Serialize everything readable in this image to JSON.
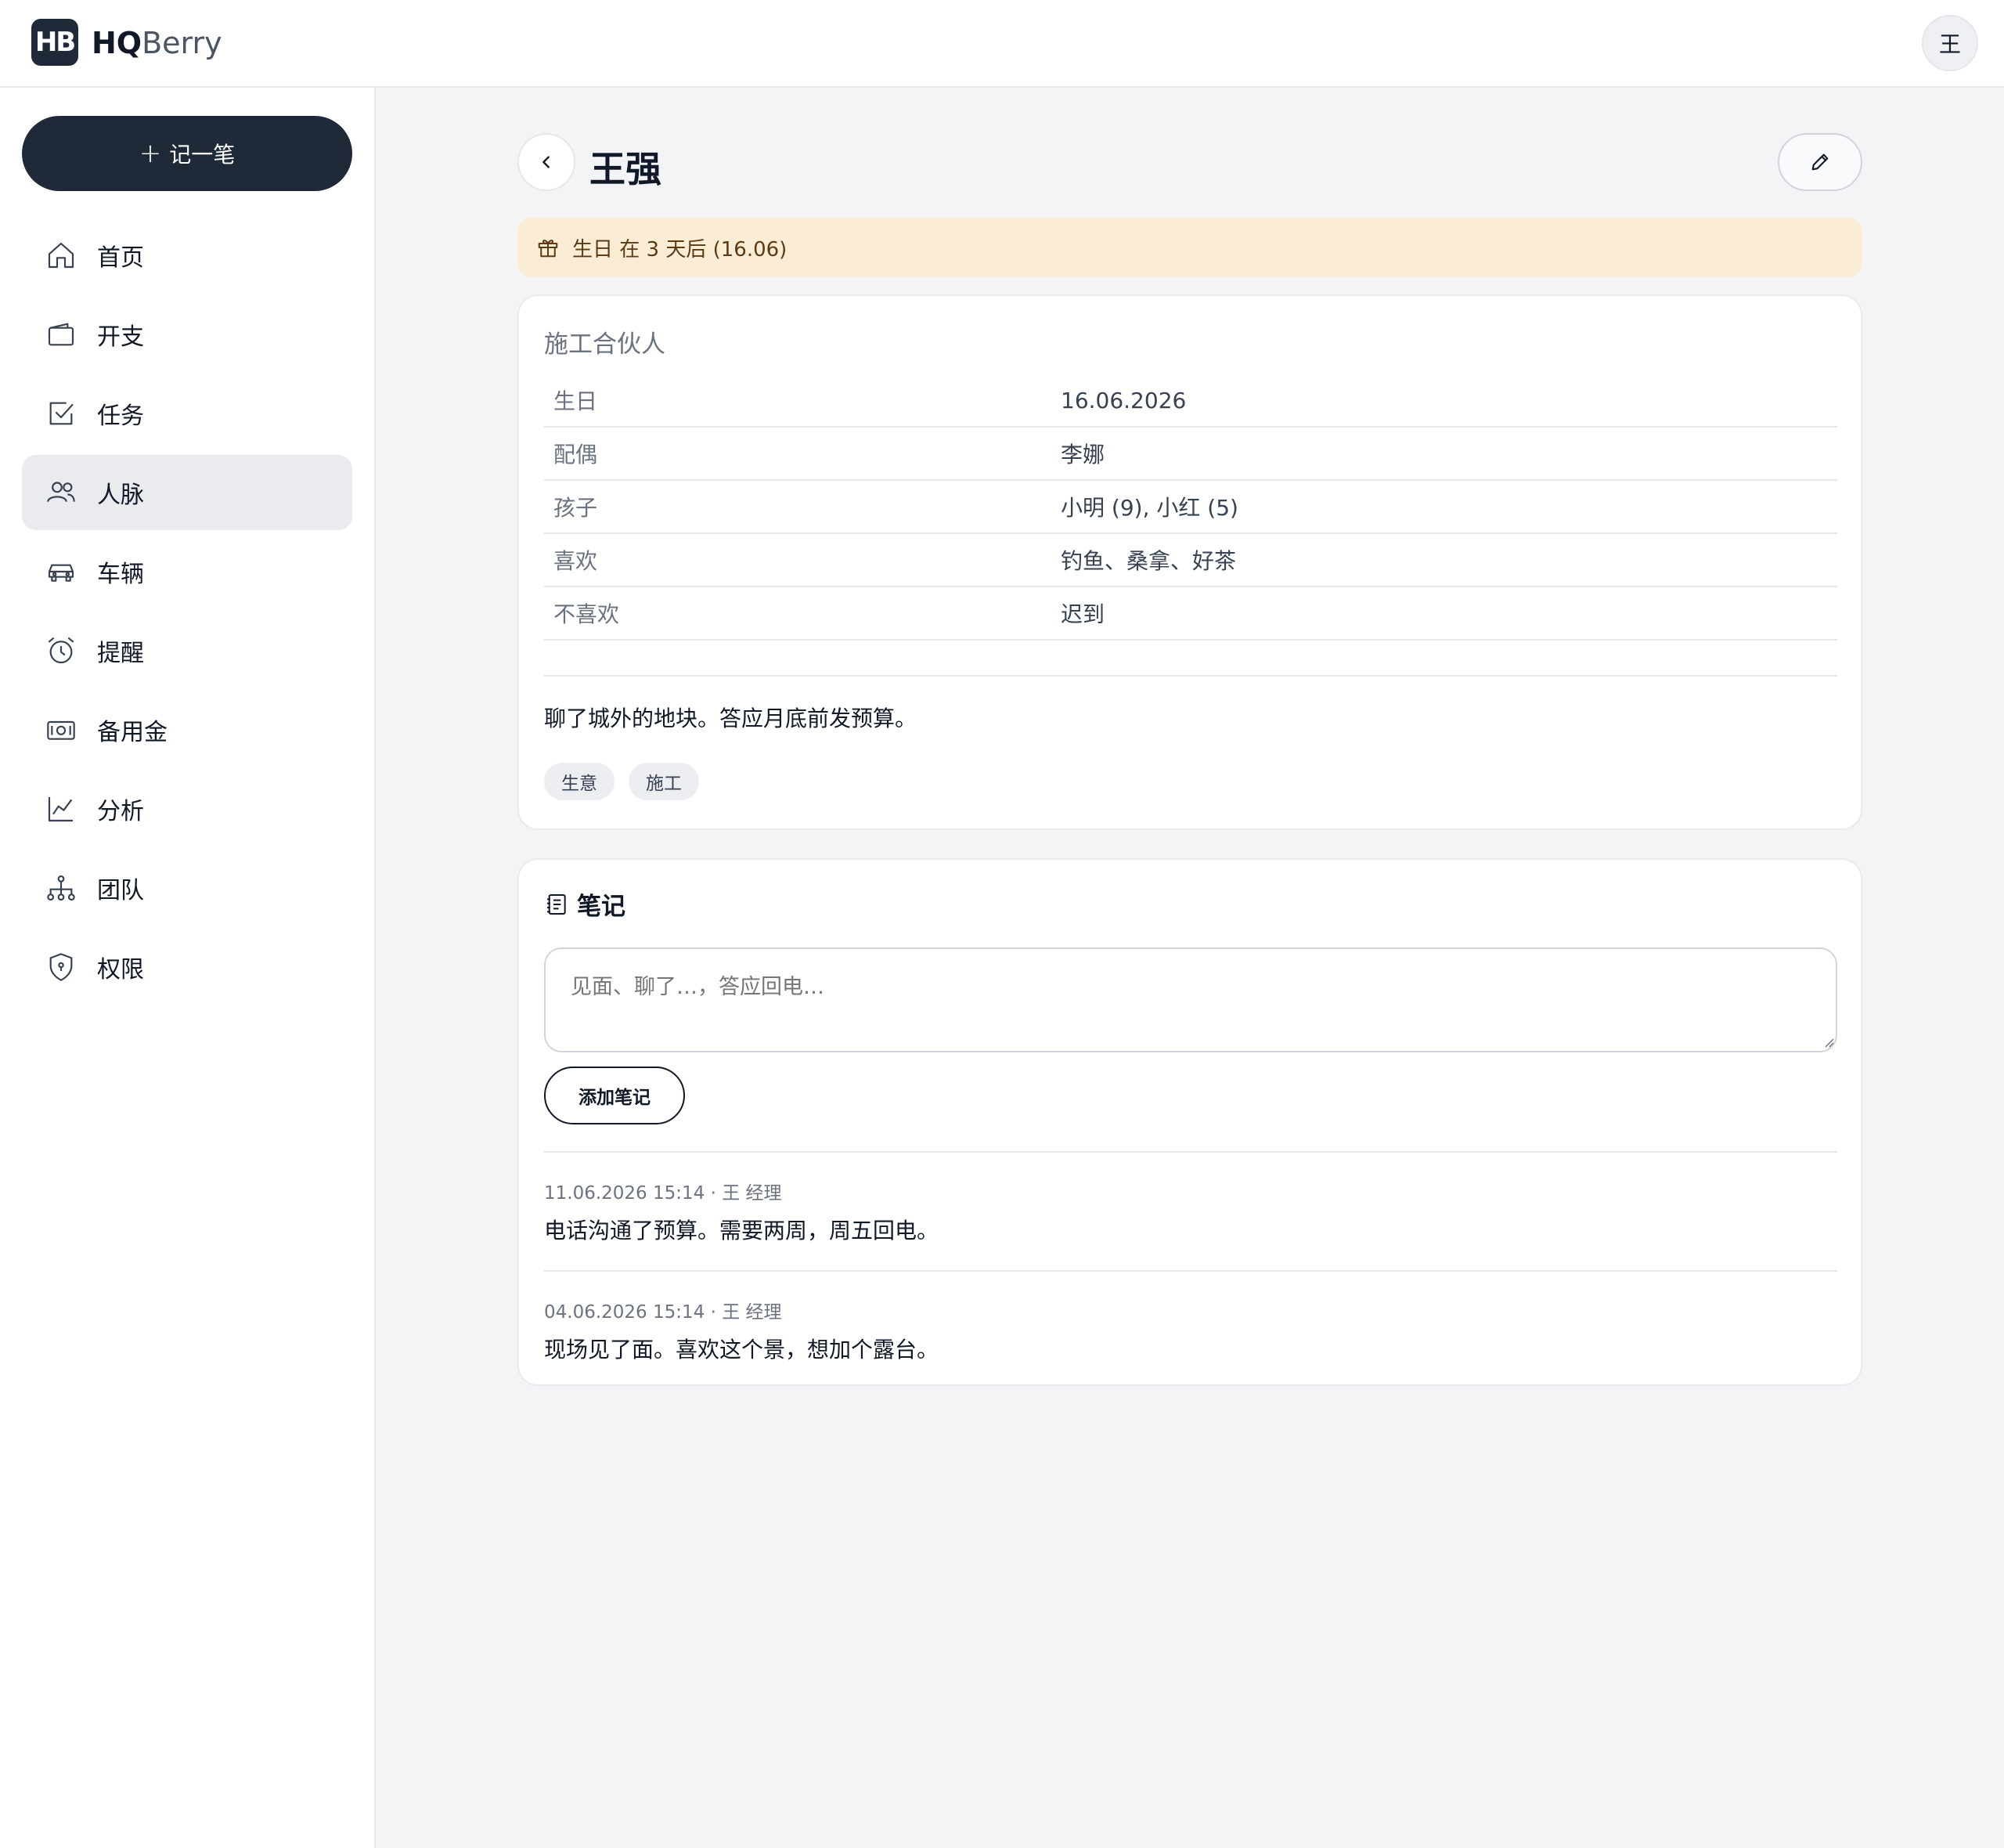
{
  "app": {
    "logo_mark": "HB",
    "logo_strong": "HQ",
    "logo_light": "Berry",
    "user_initial": "王"
  },
  "sidebar": {
    "new_button_label": "记一笔",
    "items": [
      {
        "label": "首页",
        "icon": "home-icon"
      },
      {
        "label": "开支",
        "icon": "wallet-icon"
      },
      {
        "label": "任务",
        "icon": "checkbox-icon"
      },
      {
        "label": "人脉",
        "icon": "users-icon",
        "active": true
      },
      {
        "label": "车辆",
        "icon": "car-icon"
      },
      {
        "label": "提醒",
        "icon": "alarm-clock-icon"
      },
      {
        "label": "备用金",
        "icon": "cash-icon"
      },
      {
        "label": "分析",
        "icon": "chart-icon"
      },
      {
        "label": "团队",
        "icon": "org-chart-icon"
      },
      {
        "label": "权限",
        "icon": "shield-icon"
      }
    ]
  },
  "contact": {
    "name": "王强",
    "birthday_banner": "生日 在 3 天后 (16.06)",
    "role": "施工合伙人",
    "fields": [
      {
        "key": "生日",
        "value": "16.06.2026"
      },
      {
        "key": "配偶",
        "value": "李娜"
      },
      {
        "key": "孩子",
        "value": "小明 (9), 小红 (5)"
      },
      {
        "key": "喜欢",
        "value": "钓鱼、桑拿、好茶"
      },
      {
        "key": "不喜欢",
        "value": "迟到"
      }
    ],
    "note": "聊了城外的地块。答应月底前发预算。",
    "tags": [
      "生意",
      "施工"
    ]
  },
  "notes": {
    "title": "笔记",
    "placeholder": "见面、聊了…，答应回电…",
    "add_button": "添加笔记",
    "entries": [
      {
        "meta": "11.06.2026 15:14 · 王 经理",
        "text": "电话沟通了预算。需要两周，周五回电。"
      },
      {
        "meta": "04.06.2026 15:14 · 王 经理",
        "text": "现场见了面。喜欢这个景，想加个露台。"
      }
    ]
  },
  "colors": {
    "accent_dark": "#1f2937",
    "banner_bg": "#fbecd6",
    "page_bg": "#f3f4f6"
  }
}
